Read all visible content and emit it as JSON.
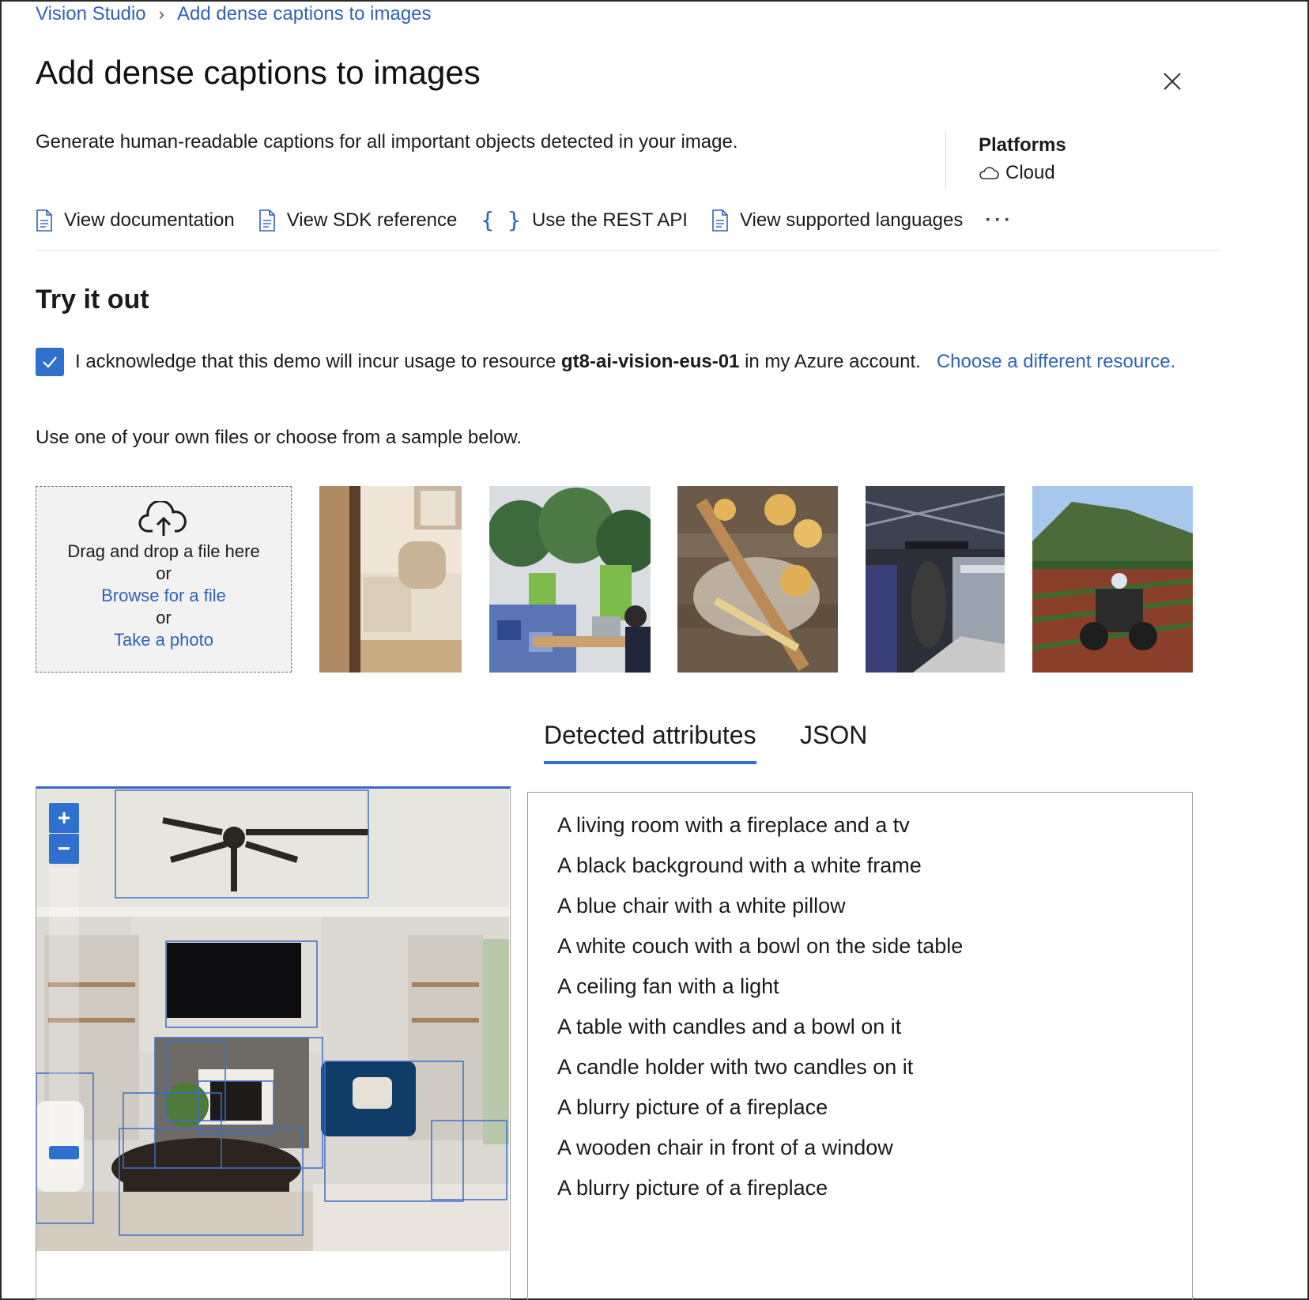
{
  "breadcrumb": {
    "root": "Vision Studio",
    "current": "Add dense captions to images"
  },
  "page": {
    "title": "Add dense captions to images",
    "description": "Generate human-readable captions for all important objects detected in your image."
  },
  "platforms": {
    "label": "Platforms",
    "value": "Cloud",
    "icon": "cloud-icon"
  },
  "links": [
    {
      "label": "View documentation",
      "icon": "document-icon"
    },
    {
      "label": "View SDK reference",
      "icon": "document-icon"
    },
    {
      "label": "Use the REST API",
      "icon": "braces-icon"
    },
    {
      "label": "View supported languages",
      "icon": "document-icon"
    }
  ],
  "more_label": "···",
  "try_it": {
    "title": "Try it out",
    "ack_prefix": "I acknowledge that this demo will incur usage to resource",
    "resource": "gt8-ai-vision-eus-01",
    "ack_suffix": "in my Azure account.",
    "change_link": "Choose a different resource.",
    "checked": true,
    "use_files": "Use one of your own files or choose from a sample below."
  },
  "dropzone": {
    "drag": "Drag and drop a file here",
    "or1": "or",
    "browse": "Browse for a file",
    "or2": "or",
    "photo": "Take a photo"
  },
  "tabs": {
    "detected": "Detected attributes",
    "json": "JSON"
  },
  "zoom": {
    "in": "+",
    "out": "−"
  },
  "captions": [
    "A living room with a fireplace and a tv",
    "A black background with a white frame",
    "A blue chair with a white pillow",
    "A white couch with a bowl on the side table",
    "A ceiling fan with a light",
    "A table with candles and a bowl on it",
    "A candle holder with two candles on it",
    "A blurry picture of a fireplace",
    "A wooden chair in front of a window",
    "A blurry picture of a fireplace"
  ],
  "colors": {
    "accent": "#2f6fce",
    "link": "#2f63b8"
  }
}
